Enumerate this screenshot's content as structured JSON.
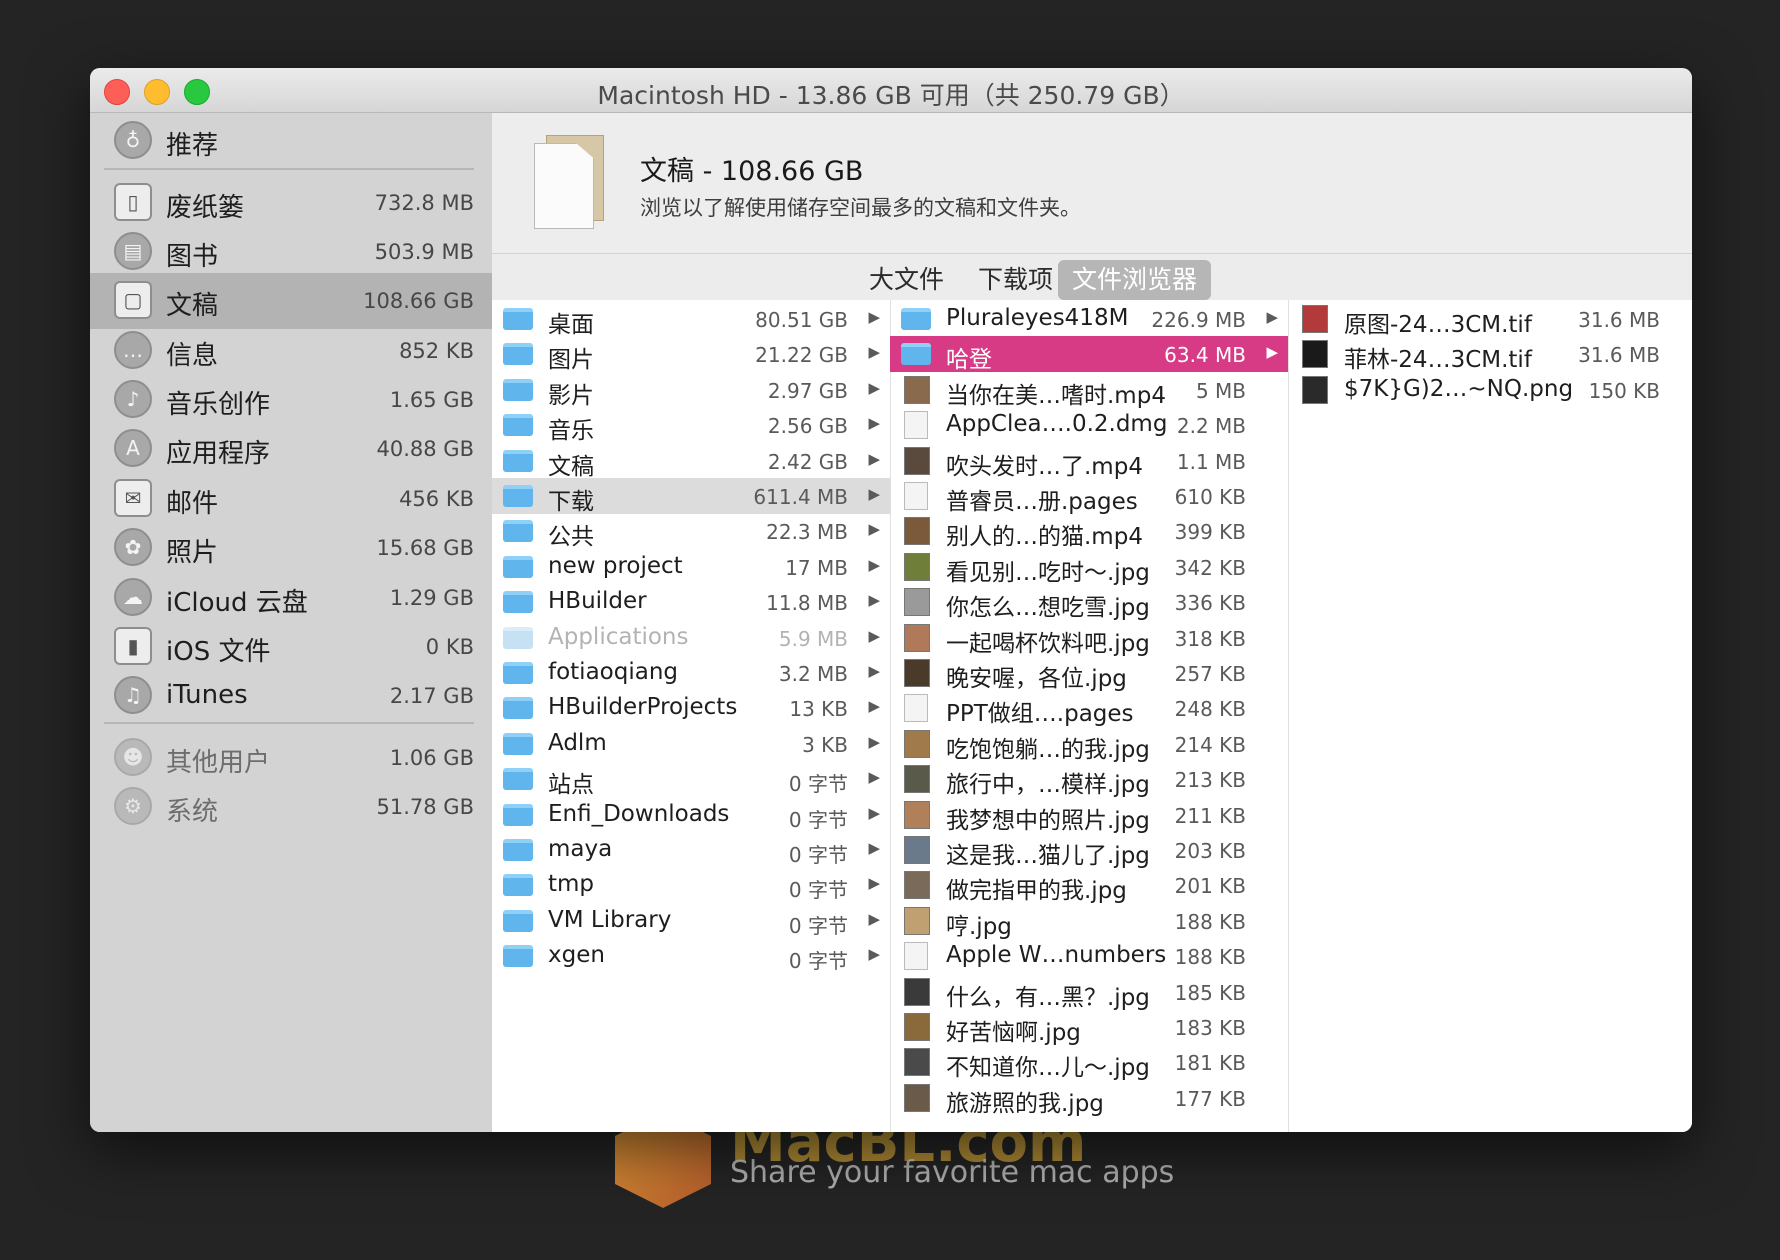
{
  "watermark": {
    "brand": "MacBL.com",
    "tagline": "Share your favorite mac apps"
  },
  "window": {
    "title": "Macintosh HD - 13.86 GB 可用（共 250.79 GB）"
  },
  "sidebar": {
    "items": [
      {
        "label": "推荐",
        "size": "",
        "icon": "lightbulb-icon"
      },
      {
        "label": "废纸篓",
        "size": "732.8 MB",
        "icon": "trash-icon"
      },
      {
        "label": "图书",
        "size": "503.9 MB",
        "icon": "book-icon"
      },
      {
        "label": "文稿",
        "size": "108.66 GB",
        "icon": "document-icon",
        "selected": true
      },
      {
        "label": "信息",
        "size": "852 KB",
        "icon": "messages-icon"
      },
      {
        "label": "音乐创作",
        "size": "1.65 GB",
        "icon": "guitar-icon"
      },
      {
        "label": "应用程序",
        "size": "40.88 GB",
        "icon": "app-store-icon"
      },
      {
        "label": "邮件",
        "size": "456 KB",
        "icon": "mail-icon"
      },
      {
        "label": "照片",
        "size": "15.68 GB",
        "icon": "photos-icon"
      },
      {
        "label": "iCloud 云盘",
        "size": "1.29 GB",
        "icon": "cloud-icon"
      },
      {
        "label": "iOS 文件",
        "size": "0 KB",
        "icon": "iphone-icon"
      },
      {
        "label": "iTunes",
        "size": "2.17 GB",
        "icon": "music-note-icon"
      },
      {
        "label": "其他用户",
        "size": "1.06 GB",
        "icon": "users-icon"
      },
      {
        "label": "系统",
        "size": "51.78 GB",
        "icon": "gear-icon"
      }
    ]
  },
  "header": {
    "title": "文稿 - 108.66 GB",
    "subtitle": "浏览以了解使用储存空间最多的文稿和文件夹。"
  },
  "tabs": [
    {
      "label": "大文件",
      "active": false
    },
    {
      "label": "下载项",
      "active": false
    },
    {
      "label": "文件浏览器",
      "active": true
    }
  ],
  "browser": {
    "col1": [
      {
        "name": "桌面",
        "size": "80.51 GB"
      },
      {
        "name": "图片",
        "size": "21.22 GB"
      },
      {
        "name": "影片",
        "size": "2.97 GB"
      },
      {
        "name": "音乐",
        "size": "2.56 GB"
      },
      {
        "name": "文稿",
        "size": "2.42 GB"
      },
      {
        "name": "下载",
        "size": "611.4 MB",
        "selected": true
      },
      {
        "name": "公共",
        "size": "22.3 MB"
      },
      {
        "name": "new project",
        "size": "17 MB"
      },
      {
        "name": "HBuilder",
        "size": "11.8 MB"
      },
      {
        "name": "Applications",
        "size": "5.9 MB",
        "dim": true
      },
      {
        "name": "fotiaoqiang",
        "size": "3.2 MB"
      },
      {
        "name": "HBuilderProjects",
        "size": "13 KB"
      },
      {
        "name": "Adlm",
        "size": "3 KB"
      },
      {
        "name": "站点",
        "size": "0 字节"
      },
      {
        "name": "Enfi_Downloads",
        "size": "0 字节"
      },
      {
        "name": "maya",
        "size": "0 字节"
      },
      {
        "name": "tmp",
        "size": "0 字节"
      },
      {
        "name": "VM Library",
        "size": "0 字节"
      },
      {
        "name": "xgen",
        "size": "0 字节"
      }
    ],
    "col2": [
      {
        "name": "Pluraleyes418M",
        "size": "226.9 MB",
        "kind": "folder"
      },
      {
        "name": "哈登",
        "size": "63.4 MB",
        "kind": "folder",
        "selected": true
      },
      {
        "name": "当你在美…嗜时.mp4",
        "size": "5 MB",
        "kind": "thumb",
        "color": "#8a6a4c"
      },
      {
        "name": "AppClea….0.2.dmg",
        "size": "2.2 MB",
        "kind": "file"
      },
      {
        "name": "吹头发时…了.mp4",
        "size": "1.1 MB",
        "kind": "thumb",
        "color": "#5a4a3e"
      },
      {
        "name": "普睿员…册.pages",
        "size": "610 KB",
        "kind": "file"
      },
      {
        "name": "别人的…的猫.mp4",
        "size": "399 KB",
        "kind": "thumb",
        "color": "#7a5a3a"
      },
      {
        "name": "看见别…吃时～.jpg",
        "size": "342 KB",
        "kind": "thumb",
        "color": "#6f7f3a"
      },
      {
        "name": "你怎么…想吃雪.jpg",
        "size": "336 KB",
        "kind": "thumb",
        "color": "#9a9a9a"
      },
      {
        "name": "一起喝杯饮料吧.jpg",
        "size": "318 KB",
        "kind": "thumb",
        "color": "#b07a5a"
      },
      {
        "name": "晚安喔，各位.jpg",
        "size": "257 KB",
        "kind": "thumb",
        "color": "#4a3a2a"
      },
      {
        "name": "PPT做组….pages",
        "size": "248 KB",
        "kind": "file"
      },
      {
        "name": "吃饱饱躺…的我.jpg",
        "size": "214 KB",
        "kind": "thumb",
        "color": "#a07a4a"
      },
      {
        "name": "旅行中，…模样.jpg",
        "size": "213 KB",
        "kind": "thumb",
        "color": "#5a5a4a"
      },
      {
        "name": "我梦想中的照片.jpg",
        "size": "211 KB",
        "kind": "thumb",
        "color": "#b0805a"
      },
      {
        "name": "这是我…猫儿了.jpg",
        "size": "203 KB",
        "kind": "thumb",
        "color": "#6a7a8a"
      },
      {
        "name": "做完指甲的我.jpg",
        "size": "201 KB",
        "kind": "thumb",
        "color": "#7a6a5a"
      },
      {
        "name": "哼.jpg",
        "size": "188 KB",
        "kind": "thumb",
        "color": "#c0a070"
      },
      {
        "name": "Apple W…numbers",
        "size": "188 KB",
        "kind": "file"
      },
      {
        "name": "什么，有…黑？.jpg",
        "size": "185 KB",
        "kind": "thumb",
        "color": "#3a3a3a"
      },
      {
        "name": "好苦恼啊.jpg",
        "size": "183 KB",
        "kind": "thumb",
        "color": "#8a6a3a"
      },
      {
        "name": "不知道你…儿～.jpg",
        "size": "181 KB",
        "kind": "thumb",
        "color": "#4a4a4a"
      },
      {
        "name": "旅游照的我.jpg",
        "size": "177 KB",
        "kind": "thumb",
        "color": "#6a5a4a"
      }
    ],
    "col3": [
      {
        "name": "原图-24…3CM.tif",
        "size": "31.6 MB",
        "color": "#b23a3a"
      },
      {
        "name": "菲林-24…3CM.tif",
        "size": "31.6 MB",
        "color": "#1a1a1a"
      },
      {
        "name": "$7K}G)2…~NQ.png",
        "size": "150 KB",
        "color": "#2a2a2a"
      }
    ]
  }
}
